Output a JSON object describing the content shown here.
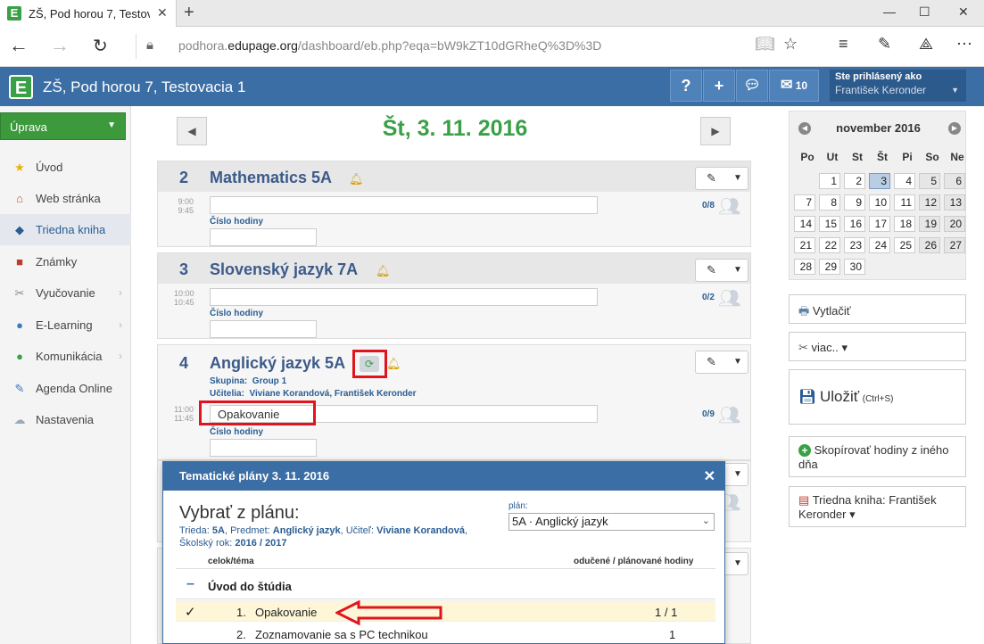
{
  "browser": {
    "tab_title": "ZŠ, Pod horou 7, Testovacia",
    "url_prefix": "podhora.",
    "url_domain": "edupage.org",
    "url_path": "/dashboard/eb.php?eqa=bW9kZT10dGRheQ%3D%3D"
  },
  "app": {
    "name": "ZŠ, Pod horou 7, Testovacia 1",
    "logo": "E",
    "help_label": "?",
    "add_label": "+",
    "messages_count": "10",
    "user_label": "Ste prihlásený ako",
    "user_name": "František Keronder"
  },
  "sidebar": {
    "action_label": "Úprava",
    "items": [
      {
        "label": "Úvod"
      },
      {
        "label": "Web stránka"
      },
      {
        "label": "Triedna kniha"
      },
      {
        "label": "Známky"
      },
      {
        "label": "Vyučovanie"
      },
      {
        "label": "E-Learning"
      },
      {
        "label": "Komunikácia"
      },
      {
        "label": "Agenda Online"
      },
      {
        "label": "Nastavenia"
      }
    ]
  },
  "main": {
    "date_title": "Št, 3. 11. 2016",
    "hour_number_label": "Číslo hodiny",
    "lessons": [
      {
        "num": "2",
        "subject": "Mathematics  5A",
        "time_start": "9:00",
        "time_end": "9:45",
        "topic": "",
        "count": "0/8"
      },
      {
        "num": "3",
        "subject": "Slovenský jazyk  7A",
        "time_start": "10:00",
        "time_end": "10:45",
        "topic": "",
        "count": "0/2"
      },
      {
        "num": "4",
        "subject": "Anglický jazyk  5A",
        "time_start": "11:00",
        "time_end": "11:45",
        "topic": "Opakovanie",
        "count": "0/9",
        "group_label": "Skupina:",
        "group_value": "Group 1",
        "teachers_label": "Učitelia:",
        "teachers_value": "Viviane Korandová, František Keronder"
      }
    ]
  },
  "calendar": {
    "month": "november 2016",
    "weekdays": [
      "Po",
      "Ut",
      "St",
      "Št",
      "Pi",
      "So",
      "Ne"
    ],
    "weeks": [
      [
        "",
        "1",
        "2",
        "3",
        "4",
        "5",
        "6"
      ],
      [
        "7",
        "8",
        "9",
        "10",
        "11",
        "12",
        "13"
      ],
      [
        "14",
        "15",
        "16",
        "17",
        "18",
        "19",
        "20"
      ],
      [
        "21",
        "22",
        "23",
        "24",
        "25",
        "26",
        "27"
      ],
      [
        "28",
        "29",
        "30",
        "",
        "",
        "",
        ""
      ]
    ],
    "today": "3"
  },
  "right_buttons": {
    "print": "Vytlačiť",
    "more": "viac.. ▾",
    "save": "Uložiť",
    "save_shortcut": "(Ctrl+S)",
    "copy": "Skopírovať hodiny z iného dňa",
    "classbook": "Triedna kniha: František Keronder ▾"
  },
  "modal": {
    "title": "Tematické plány 3. 11. 2016",
    "heading": "Vybrať z plánu:",
    "class_label": "Trieda:",
    "class_value": "5A",
    "subject_label": "Predmet:",
    "subject_value": "Anglický jazyk",
    "teacher_label": "Učiteľ:",
    "teacher_value": "Viviane Korandová",
    "year_label": "Školský rok:",
    "year_value": "2016 / 2017",
    "plan_label": "plán:",
    "plan_value": "5A · Anglický jazyk",
    "col_topic": "celok/téma",
    "col_hours": "odučené / plánované hodiny",
    "section_name": "Úvod do štúdia",
    "rows": [
      {
        "num": "1.",
        "name": "Opakovanie",
        "hours": "1 / 1",
        "checked": true
      },
      {
        "num": "2.",
        "name": "Zoznamovanie sa s PC technikou",
        "hours": "1",
        "checked": false
      }
    ]
  },
  "colors": {
    "brand_blue": "#3b6ea5",
    "brand_green": "#3aa047",
    "highlight_red": "#e0141e"
  }
}
